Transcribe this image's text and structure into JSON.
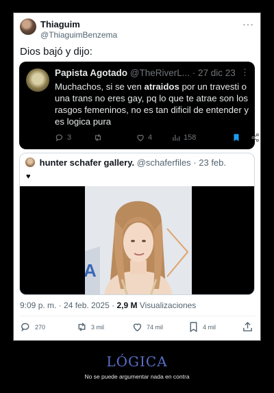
{
  "tweet": {
    "name": "Thiaguim",
    "handle": "@ThiaguimBenzema",
    "more": "···",
    "text": "Dios bajó y dijo:",
    "timestamp": "9:09 p. m. · 24 feb. 2025 ·",
    "views_count": "2,9 M",
    "views_label": "Visualizaciones",
    "actions": {
      "replies": "270",
      "retweets": "3 mil",
      "likes": "74 mil",
      "bookmarks": "4 mil"
    }
  },
  "embedded": {
    "name": "Papista Agotado",
    "handle": "@TheRiverL...",
    "date": "· 27 dic 23",
    "more": "⋮",
    "text_before": "Muchachos, si se ven ",
    "text_bold": "atraidos",
    "text_after": " por un travesti o una trans no eres gay, pq lo que te atrae son los rasgos femeninos, no es tan dificil de entender y es logica pura",
    "replies": "3",
    "likes": "4",
    "views": "158",
    "colors": {
      "background": "#000000",
      "bookmark": "#1d9bf0"
    }
  },
  "quote": {
    "name": "hunter schafer gallery.",
    "handle": "@schaferfiles",
    "date": "· 23 feb.",
    "heart": "♥"
  },
  "caption": {
    "title": "LÓGICA",
    "subtitle": "No se puede argumentar nada en contra"
  }
}
